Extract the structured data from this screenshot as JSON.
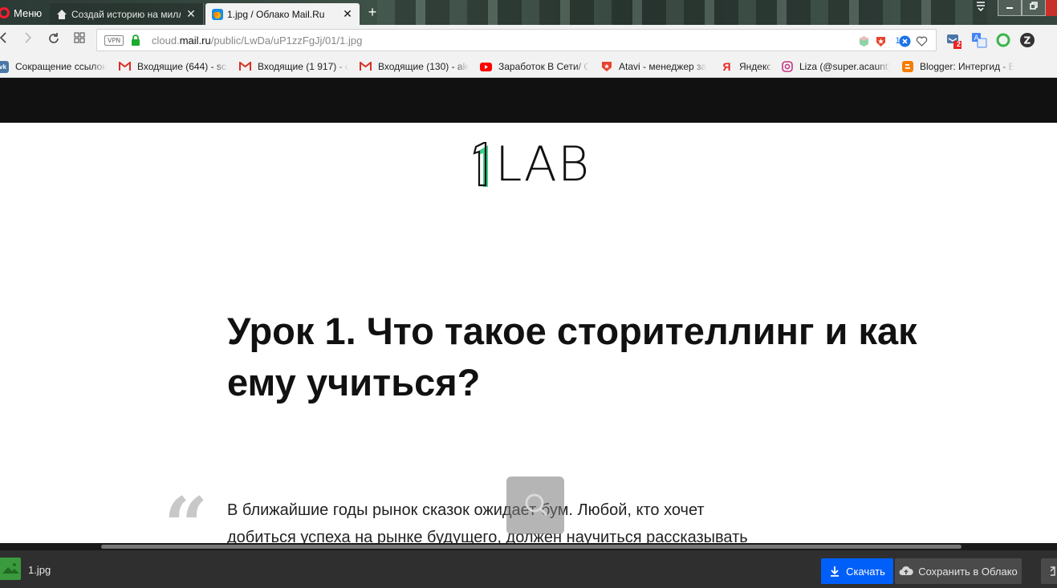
{
  "browser": {
    "menu_label": "Меню",
    "tabs": [
      {
        "title": "Создай историю на милл",
        "active": false
      },
      {
        "title": "1.jpg / Облако Mail.Ru",
        "active": true
      }
    ],
    "tab_close_glyph": "✕",
    "new_tab_glyph": "+",
    "vpn_badge": "VPN",
    "url": {
      "prefix": "cloud.",
      "domain": "mail.ru",
      "path": "/public/LwDa/uP1zzFgJj/01/1.jpg"
    },
    "extension_badge": "1",
    "vk_notification_count": "2",
    "colors": {
      "opera_red": "#ff1b2d",
      "address_bg": "#f2f2f2",
      "secure_green": "#1aab2f"
    }
  },
  "bookmarks": [
    {
      "label": "Сокращение ссылок",
      "icon": "vk-icon"
    },
    {
      "label": "Входящие (644) - sca",
      "icon": "gmail-icon"
    },
    {
      "label": "Входящие (1 917) - c",
      "icon": "gmail-icon"
    },
    {
      "label": "Входящие (130) - ale",
      "icon": "gmail-icon"
    },
    {
      "label": "Заработок В Сети/ С",
      "icon": "youtube-icon"
    },
    {
      "label": "Atavi - менеджер за",
      "icon": "atavi-icon"
    },
    {
      "label": "Яндекс",
      "icon": "yandex-icon"
    },
    {
      "label": "Liza (@super.acaunt)",
      "icon": "instagram-icon"
    },
    {
      "label": "Blogger: Интергид - E",
      "icon": "blogger-icon"
    }
  ],
  "document": {
    "logo_text": "LAB",
    "lesson_title": "Урок 1. Что такое сторителлинг и как ему учиться?",
    "quote_mark": "“",
    "quote_line1": "В ближайшие годы рынок сказок ожидает бум. Любой, кто хочет",
    "quote_line2": "добиться успеха на рынке будущего, должен научиться рассказывать"
  },
  "viewer_bar": {
    "file_name": "1.jpg",
    "download_label": "Скачать",
    "save_label": "Сохранить в Облако",
    "colors": {
      "download_blue": "#005ff9",
      "bar_bg": "#2f2f2f"
    }
  }
}
